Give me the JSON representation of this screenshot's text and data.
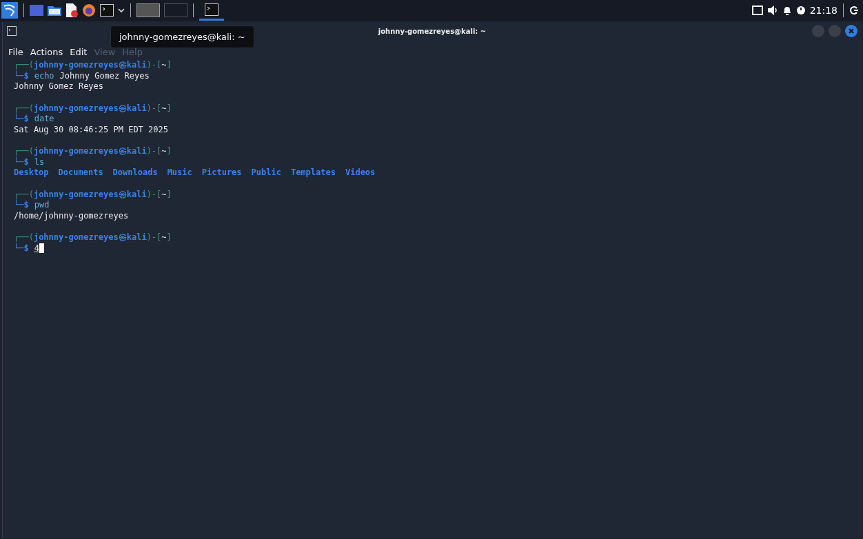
{
  "taskbar": {
    "clock": "21:18"
  },
  "tooltip": "johnny-gomezreyes@kali: ~",
  "window": {
    "title": "johnny-gomezreyes@kali: ~"
  },
  "menu": [
    {
      "label": "File",
      "dimmed": false
    },
    {
      "label": "Actions",
      "dimmed": false
    },
    {
      "label": "Edit",
      "dimmed": false
    },
    {
      "label": "View",
      "dimmed": true
    },
    {
      "label": "Help",
      "dimmed": true
    }
  ],
  "terminal": [
    {
      "top": "┌──(",
      "user": "johnny-gomezreyes",
      "at": "㉿",
      "host": "kali",
      "mid": ")-[",
      "dir": "~",
      "end": "]",
      "bottom": "└─$",
      "command": "echo",
      "args": "Johnny Gomez Reyes",
      "output": {
        "kind": "text",
        "lines": [
          "Johnny Gomez Reyes"
        ]
      }
    },
    {
      "top": "┌──(",
      "user": "johnny-gomezreyes",
      "at": "㉿",
      "host": "kali",
      "mid": ")-[",
      "dir": "~",
      "end": "]",
      "bottom": "└─$",
      "command": "date",
      "output": {
        "kind": "text",
        "lines": [
          "Sat Aug 30 08:46:25 PM EDT 2025"
        ]
      }
    },
    {
      "top": "┌──(",
      "user": "johnny-gomezreyes",
      "at": "㉿",
      "host": "kali",
      "mid": ")-[",
      "dir": "~",
      "end": "]",
      "bottom": "└─$",
      "command": "ls",
      "output": {
        "kind": "dirs",
        "items": [
          "Desktop",
          "Documents",
          "Downloads",
          "Music",
          "Pictures",
          "Public",
          "Templates",
          "Videos"
        ]
      }
    },
    {
      "top": "┌──(",
      "user": "johnny-gomezreyes",
      "at": "㉿",
      "host": "kali",
      "mid": ")-[",
      "dir": "~",
      "end": "]",
      "bottom": "└─$",
      "command": "pwd",
      "output": {
        "kind": "text",
        "lines": [
          "/home/johnny-gomezreyes"
        ]
      }
    },
    {
      "top": "┌──(",
      "user": "johnny-gomezreyes",
      "at": "㉿",
      "host": "kali",
      "mid": ")-[",
      "dir": "~",
      "end": "]",
      "bottom": "└─$",
      "input": "4"
    }
  ]
}
